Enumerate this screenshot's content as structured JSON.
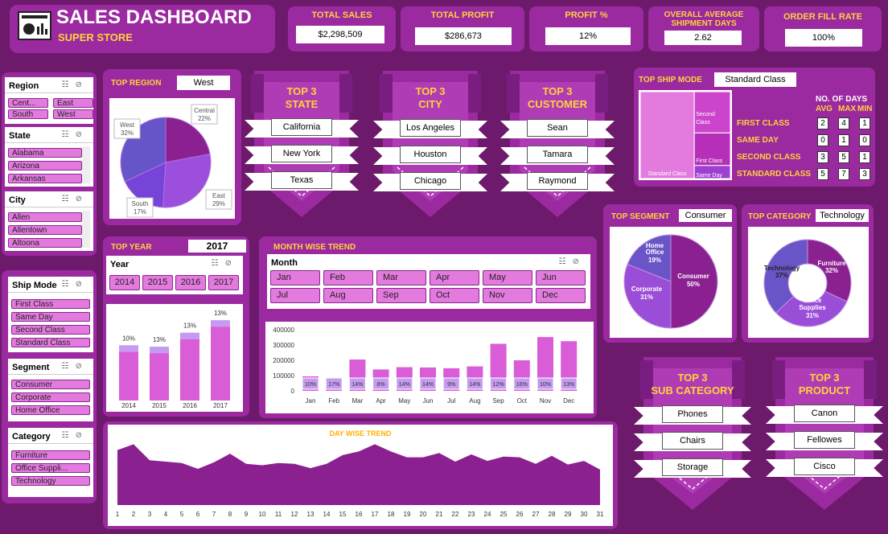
{
  "header": {
    "title": "SALES DASHBOARD",
    "subtitle": "SUPER STORE",
    "icon": "dashboard-icon"
  },
  "kpis": [
    {
      "label": "TOTAL SALES",
      "value": "$2,298,509"
    },
    {
      "label": "TOTAL PROFIT",
      "value": "$286,673"
    },
    {
      "label": "PROFIT %",
      "value": "12%"
    },
    {
      "label": "OVERALL AVERAGE SHIPMENT DAYS",
      "value": "2.62"
    },
    {
      "label": "ORDER FILL RATE",
      "value": "100%"
    }
  ],
  "slicers": {
    "region": {
      "title": "Region",
      "items": [
        "Cent...",
        "East",
        "South",
        "West"
      ]
    },
    "state": {
      "title": "State",
      "items": [
        "Alabama",
        "Arizona",
        "Arkansas"
      ]
    },
    "city": {
      "title": "City",
      "items": [
        "Allen",
        "Allentown",
        "Altoona"
      ]
    },
    "ship_mode": {
      "title": "Ship Mode",
      "items": [
        "First Class",
        "Same Day",
        "Second Class",
        "Standard Class"
      ]
    },
    "segment": {
      "title": "Segment",
      "items": [
        "Consumer",
        "Corporate",
        "Home Office"
      ]
    },
    "category": {
      "title": "Category",
      "items": [
        "Furniture",
        "Office Suppli...",
        "Technology"
      ]
    },
    "year": {
      "title": "Year",
      "items": [
        "2014",
        "2015",
        "2016",
        "2017"
      ]
    },
    "month": {
      "title": "Month",
      "items": [
        "Jan",
        "Feb",
        "Mar",
        "Apr",
        "May",
        "Jun",
        "Jul",
        "Aug",
        "Sep",
        "Oct",
        "Nov",
        "Dec"
      ]
    }
  },
  "top_region": {
    "title": "TOP REGION",
    "value": "West"
  },
  "top_year": {
    "title": "TOP YEAR",
    "value": "2017"
  },
  "top_ship_mode": {
    "title": "TOP SHIP MODE",
    "value": "Standard Class"
  },
  "top_segment": {
    "title": "TOP SEGMENT",
    "value": "Consumer"
  },
  "top_category": {
    "title": "TOP CATEGORY",
    "value": "Technology"
  },
  "top3_state": {
    "title1": "TOP 3",
    "title2": "STATE",
    "items": [
      "California",
      "New York",
      "Texas"
    ]
  },
  "top3_city": {
    "title1": "TOP 3",
    "title2": "CITY",
    "items": [
      "Los Angeles",
      "Houston",
      "Chicago"
    ]
  },
  "top3_customer": {
    "title1": "TOP 3",
    "title2": "CUSTOMER",
    "items": [
      "Sean",
      "Tamara",
      "Raymond"
    ]
  },
  "top3_subcategory": {
    "title1": "TOP 3",
    "title2": "SUB CATEGORY",
    "items": [
      "Phones",
      "Chairs",
      "Storage"
    ]
  },
  "top3_product": {
    "title1": "TOP 3",
    "title2": "PRODUCT",
    "items": [
      "Canon",
      "Fellowes",
      "Cisco"
    ]
  },
  "ship_days": {
    "header": "NO. OF DAYS",
    "cols": [
      "AVG",
      "MAX",
      "MIN"
    ],
    "rows": [
      {
        "label": "FIRST CLASS",
        "vals": [
          "2",
          "4",
          "1"
        ]
      },
      {
        "label": "SAME DAY",
        "vals": [
          "0",
          "1",
          "0"
        ]
      },
      {
        "label": "SECOND CLASS",
        "vals": [
          "3",
          "5",
          "1"
        ]
      },
      {
        "label": "STANDARD CLASS",
        "vals": [
          "5",
          "7",
          "3"
        ]
      }
    ]
  },
  "month_title": "MONTH WISE TREND",
  "day_title": "DAY WISE TREND",
  "chart_data": [
    {
      "id": "region",
      "type": "pie",
      "slices": [
        {
          "name": "Central",
          "pct": "22%",
          "value": 22
        },
        {
          "name": "East",
          "pct": "29%",
          "value": 29
        },
        {
          "name": "South",
          "pct": "17%",
          "value": 17
        },
        {
          "name": "West",
          "pct": "32%",
          "value": 32
        }
      ]
    },
    {
      "id": "year",
      "type": "bar",
      "categories": [
        "2014",
        "2015",
        "2016",
        "2017"
      ],
      "values": [
        484000,
        470000,
        609000,
        733000
      ],
      "profit_pct": [
        "10%",
        "13%",
        "13%",
        "13%"
      ]
    },
    {
      "id": "month",
      "type": "bar",
      "categories": [
        "Jan",
        "Feb",
        "Mar",
        "Apr",
        "May",
        "Jun",
        "Jul",
        "Aug",
        "Sep",
        "Oct",
        "Nov",
        "Dec"
      ],
      "values": [
        95000,
        60000,
        205000,
        140000,
        155000,
        153000,
        148000,
        160000,
        308000,
        200000,
        352000,
        325000
      ],
      "profit_pct": [
        "10%",
        "17%",
        "14%",
        "8%",
        "14%",
        "14%",
        "9%",
        "14%",
        "12%",
        "16%",
        "10%",
        "13%"
      ],
      "yticks": [
        "0",
        "100000",
        "200000",
        "300000",
        "400000"
      ],
      "ylim": [
        0,
        400000
      ]
    },
    {
      "id": "segment",
      "type": "pie",
      "slices": [
        {
          "name": "Consumer",
          "pct": "50%",
          "value": 50
        },
        {
          "name": "Corporate",
          "pct": "31%",
          "value": 31
        },
        {
          "name": "Home Office",
          "pct": "19%",
          "value": 19
        }
      ]
    },
    {
      "id": "category",
      "type": "donut",
      "slices": [
        {
          "name": "Furniture",
          "pct": "32%",
          "value": 32
        },
        {
          "name": "Office Supplies",
          "pct": "31%",
          "value": 31
        },
        {
          "name": "Technology",
          "pct": "37%",
          "value": 37
        }
      ]
    },
    {
      "id": "shipmode",
      "type": "treemap",
      "items": [
        {
          "name": "Standard Class",
          "value": 60
        },
        {
          "name": "Second Class",
          "value": 19
        },
        {
          "name": "First Class",
          "value": 15
        },
        {
          "name": "Same Day",
          "value": 6
        }
      ]
    },
    {
      "id": "day",
      "type": "area",
      "x": [
        1,
        2,
        3,
        4,
        5,
        6,
        7,
        8,
        9,
        10,
        11,
        12,
        13,
        14,
        15,
        16,
        17,
        18,
        19,
        20,
        21,
        22,
        23,
        24,
        25,
        26,
        27,
        28,
        29,
        30,
        31
      ],
      "values": [
        76,
        84,
        62,
        60,
        58,
        50,
        59,
        71,
        57,
        55,
        58,
        57,
        51,
        57,
        69,
        74,
        84,
        74,
        66,
        66,
        72,
        60,
        70,
        61,
        67,
        66,
        57,
        68,
        56,
        61,
        49
      ]
    }
  ]
}
